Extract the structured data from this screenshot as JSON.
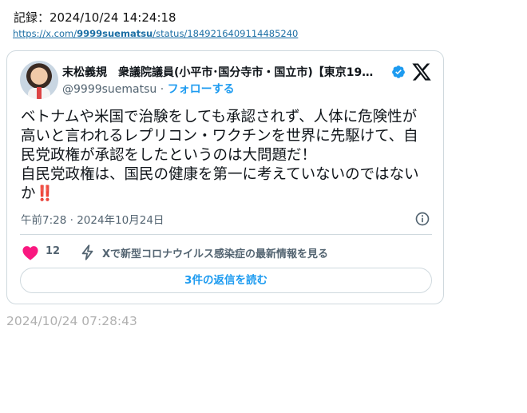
{
  "record": {
    "text": "記録：2024/10/24 14:24:18"
  },
  "source_link": {
    "prefix": "https://x.com/",
    "user": "9999suematsu",
    "suffix": "/status/1849216409114485240"
  },
  "tweet": {
    "author_name": "末松義規　衆議院議員(小平市･国分寺市・国立市)【東京19…",
    "handle": "@9999suematsu",
    "separator": " · ",
    "follow_label": "フォローする",
    "body": "ベトナムや米国で治験をしても承認されず、人体に危険性が高いと言われるレプリコン・ワクチンを世界に先駆けて、自民党政権が承認をしたというのは大問題だ！\n自民党政権は、国民の健康を第一に考えていないのではないか",
    "body_emoji": "‼️",
    "timestamp": "午前7:28 · 2024年10月24日",
    "like_count": "12",
    "covid_link": "Xで新型コロナウイルス感染症の最新情報を見る",
    "replies_label": "3件の返信を読む"
  },
  "footer": {
    "time": "2024/10/24 07:28:43"
  },
  "colors": {
    "accent": "#1d9bf0",
    "heart": "#f91880",
    "muted": "#536471"
  },
  "icons": [
    "verified-badge-icon",
    "x-logo-icon",
    "info-icon",
    "heart-icon",
    "bolt-icon"
  ]
}
